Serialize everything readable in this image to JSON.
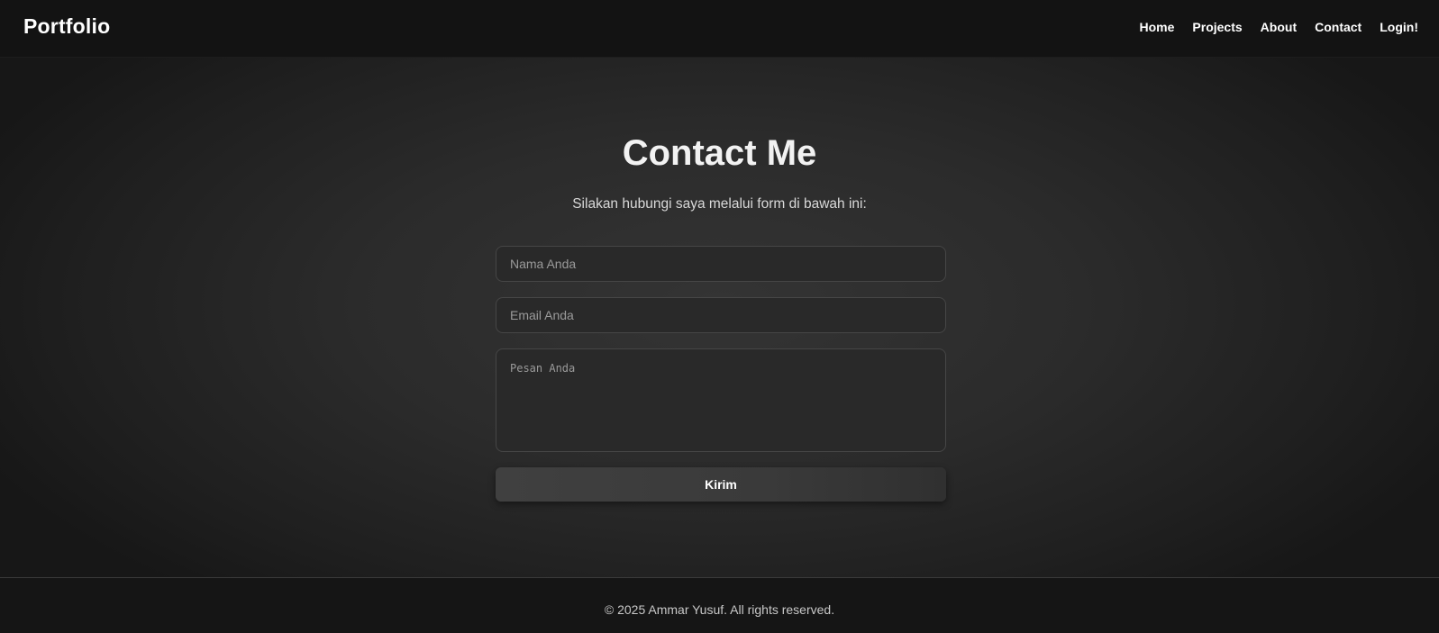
{
  "navbar": {
    "brand": "Portfolio",
    "links": [
      {
        "label": "Home"
      },
      {
        "label": "Projects"
      },
      {
        "label": "About"
      },
      {
        "label": "Contact"
      },
      {
        "label": "Login!"
      }
    ]
  },
  "contact": {
    "title": "Contact Me",
    "subtitle": "Silakan hubungi saya melalui form di bawah ini:",
    "name_placeholder": "Nama Anda",
    "name_value": "",
    "email_placeholder": "Email Anda",
    "email_value": "",
    "message_placeholder": "Pesan Anda",
    "message_value": "",
    "submit_label": "Kirim"
  },
  "footer": {
    "text": "© 2025 Ammar Yusuf. All rights reserved."
  },
  "colors": {
    "background": "#262626",
    "navbar": "#131313",
    "input_bg": "#292929",
    "input_border": "#464646",
    "button": "#3c3c3c",
    "text": "#ffffff"
  }
}
